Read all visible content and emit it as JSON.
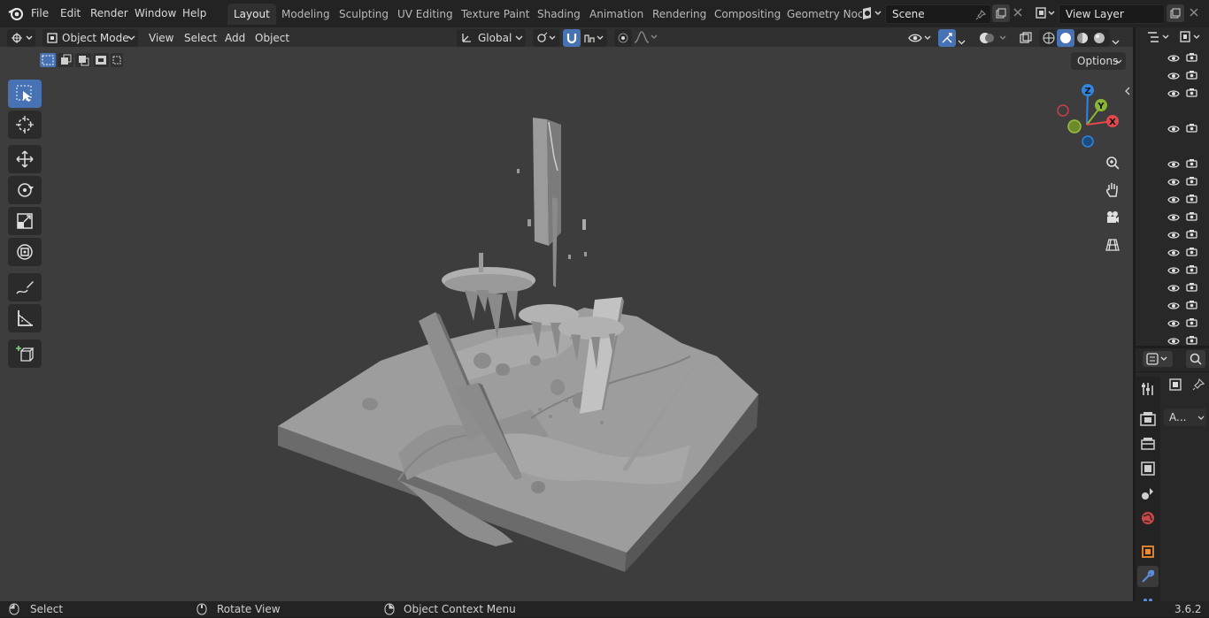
{
  "menus": [
    "File",
    "Edit",
    "Render",
    "Window",
    "Help"
  ],
  "workspaces": [
    "Layout",
    "Modeling",
    "Sculpting",
    "UV Editing",
    "Texture Paint",
    "Shading",
    "Animation",
    "Rendering",
    "Compositing",
    "Geometry Noc"
  ],
  "active_workspace": "Layout",
  "scene": {
    "name": "Scene"
  },
  "view_layer": {
    "name": "View Layer"
  },
  "viewport_header": {
    "mode": "Object Mode",
    "menus": [
      "View",
      "Select",
      "Add",
      "Object"
    ],
    "orientation": "Global",
    "options_label": "Options"
  },
  "gizmo": {
    "x": "X",
    "y": "Y",
    "z": "Z"
  },
  "properties": {
    "panel_dropdown": "A..."
  },
  "status": {
    "select": "Select",
    "rotate": "Rotate View",
    "context": "Object Context Menu",
    "version": "3.6.2"
  },
  "colors": {
    "accent": "#4772b3",
    "x_axis": "#e0484e",
    "y_axis": "#8ab733",
    "z_axis": "#2f86e0"
  }
}
